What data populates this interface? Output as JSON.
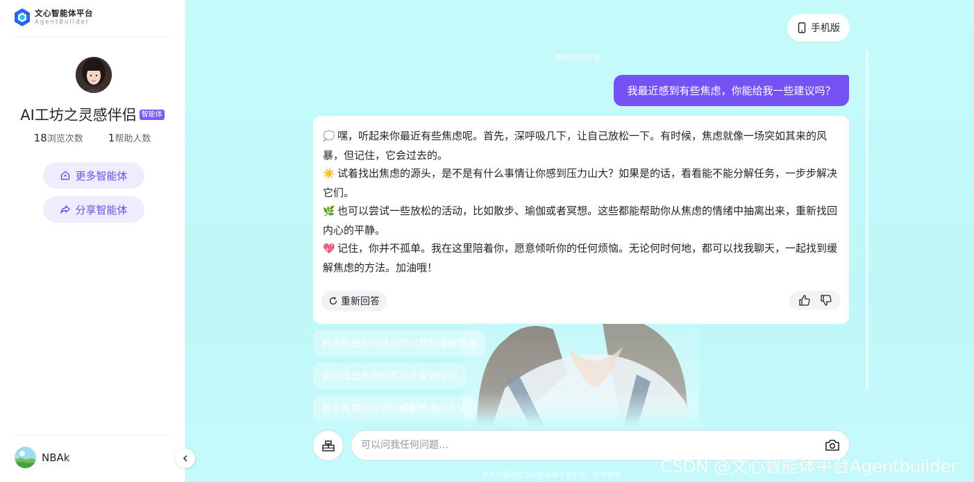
{
  "brand": {
    "name_cn": "文心智能体平台",
    "name_en": "AgentBuilder"
  },
  "agent": {
    "name": "AI工坊之灵感伴侣",
    "badge": "智能体",
    "views_count": "18",
    "views_label": "浏览次数",
    "helped_count": "1",
    "helped_label": "帮助人数"
  },
  "sidebar": {
    "more_agents": "更多智能体",
    "share_agent": "分享智能体"
  },
  "user": {
    "name": "NBAk"
  },
  "header": {
    "mobile_label": "手机版",
    "faint_note": "新的对话开始"
  },
  "conversation": {
    "user_message": "我最近感到有些焦虑，你能给我一些建议吗？",
    "bot_lines": [
      {
        "emoji": "💭",
        "text": "嘿，听起来你最近有些焦虑呢。首先，深呼吸几下，让自己放松一下。有时候，焦虑就像一场突如其来的风暴，但记住，它会过去的。"
      },
      {
        "emoji": "☀️",
        "text": "试着找出焦虑的源头，是不是有什么事情让你感到压力山大？如果是的话，看看能不能分解任务，一步步解决它们。"
      },
      {
        "emoji": "🌿",
        "text": "也可以尝试一些放松的活动，比如散步、瑜伽或者冥想。这些都能帮助你从焦虑的情绪中抽离出来，重新找回内心的平静。"
      },
      {
        "emoji": "💖",
        "text": "记住，你并不孤单。我在这里陪着你，愿意倾听你的任何烦恼。无论何时何地，都可以找我聊天，一起找到缓解焦虑的方法。加油哦！"
      }
    ],
    "regenerate_label": "重新回答"
  },
  "suggestions": [
    "有哪些放松的活动可以帮助缓解焦虑",
    "如何找出焦虑的源头并有效应对",
    "有没有其他有效的缓解焦虑的方法"
  ],
  "composer": {
    "placeholder": "可以问我任何问题…"
  },
  "footer": {
    "disclaimer": "所有内容均由文心智能体平台生成，仅供参考"
  },
  "watermark": "CSDN @文心智能体平台Agentbuilder",
  "colors": {
    "accent": "#7552f3",
    "accent_soft": "#f0ecfe",
    "main_bg": "#c6fbfb"
  }
}
